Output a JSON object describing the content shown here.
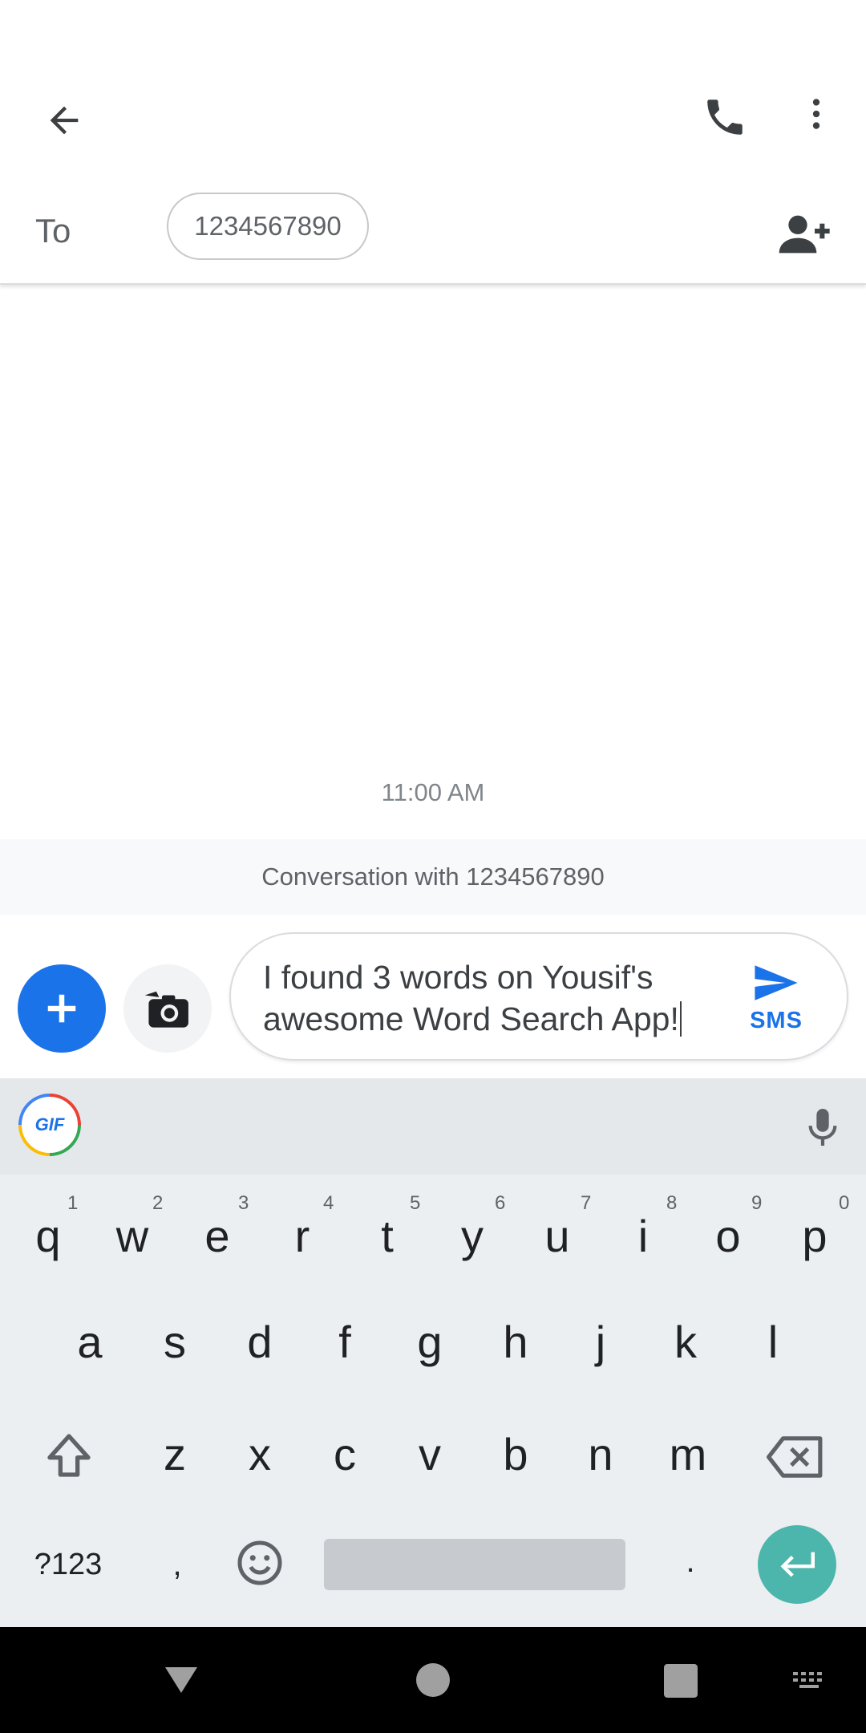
{
  "header": {
    "back_icon": "arrow-back-icon",
    "call_icon": "phone-icon",
    "more_icon": "more-vert-icon"
  },
  "to_row": {
    "label": "To",
    "recipient": "1234567890",
    "add_contact_icon": "person-add-icon"
  },
  "thread": {
    "timestamp": "11:00 AM",
    "banner": "Conversation with 1234567890"
  },
  "compose": {
    "text_line1": "I found 3 words on Yousif's",
    "text_line2": "awesome Word Search App!",
    "send_label": "SMS",
    "add_icon": "plus-icon",
    "camera_icon": "camera-icon",
    "send_icon": "send-icon",
    "accent_color": "#1a73e8"
  },
  "keyboard": {
    "gif_label": "GIF",
    "mic_icon": "microphone-icon",
    "row1": [
      "q",
      "w",
      "e",
      "r",
      "t",
      "y",
      "u",
      "i",
      "o",
      "p"
    ],
    "row1_hints": [
      "1",
      "2",
      "3",
      "4",
      "5",
      "6",
      "7",
      "8",
      "9",
      "0"
    ],
    "row2": [
      "a",
      "s",
      "d",
      "f",
      "g",
      "h",
      "j",
      "k",
      "l"
    ],
    "row3": [
      "z",
      "x",
      "c",
      "v",
      "b",
      "n",
      "m"
    ],
    "symbols_label": "?123",
    "comma": ",",
    "period": ".",
    "enter_color": "#4db6ac"
  },
  "navbar": {
    "back_icon": "nav-back-icon",
    "home_icon": "nav-home-icon",
    "recents_icon": "nav-recents-icon",
    "keyboard_icon": "keyboard-icon"
  }
}
